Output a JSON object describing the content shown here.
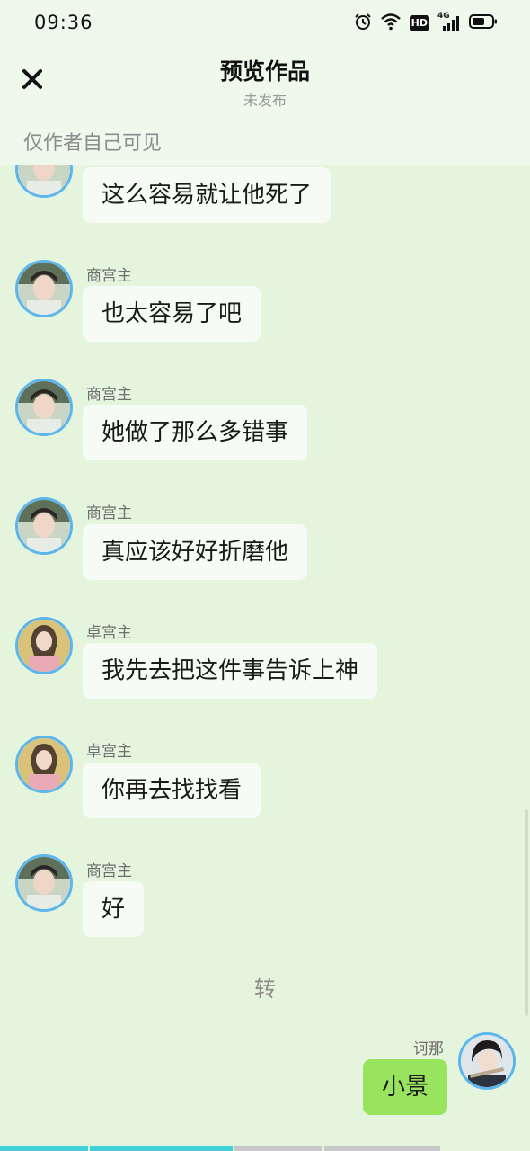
{
  "status_bar": {
    "time": "09:36",
    "icons": [
      "alarm-icon",
      "wifi-icon",
      "hd-icon",
      "4g-signal-icon",
      "battery-icon"
    ],
    "network_label": "4G",
    "hd_label": "HD"
  },
  "header": {
    "close_icon": "close-icon",
    "title": "预览作品",
    "subtitle": "未发布"
  },
  "visibility_note": "仅作者自己可见",
  "messages": [
    {
      "sender": "",
      "text": "这么容易就让他死了",
      "avatar": "avatar-shang",
      "side": "left"
    },
    {
      "sender": "商宫主",
      "text": "也太容易了吧",
      "avatar": "avatar-shang",
      "side": "left"
    },
    {
      "sender": "商宫主",
      "text": "她做了那么多错事",
      "avatar": "avatar-shang",
      "side": "left"
    },
    {
      "sender": "商宫主",
      "text": "真应该好好折磨他",
      "avatar": "avatar-shang",
      "side": "left"
    },
    {
      "sender": "卓宫主",
      "text": "我先去把这件事告诉上神",
      "avatar": "avatar-zhuo",
      "side": "left"
    },
    {
      "sender": "卓宫主",
      "text": "你再去找找看",
      "avatar": "avatar-zhuo",
      "side": "left"
    },
    {
      "sender": "商宫主",
      "text": "好",
      "avatar": "avatar-shang",
      "side": "left"
    },
    {
      "sender": "诃那",
      "text": "小景",
      "avatar": "avatar-hena",
      "side": "right"
    }
  ],
  "center_note": "转",
  "colors": {
    "background": "#e4f4dd",
    "header_bg": "#eef9eb",
    "bubble_left": "#f7fbf5",
    "bubble_right": "#98e45e",
    "avatar_ring": "#5cb6ec",
    "progress_active": "#3ed0d6"
  },
  "progress": {
    "segments_total": 5,
    "segments_done": 2,
    "current_fraction": 0.0
  }
}
